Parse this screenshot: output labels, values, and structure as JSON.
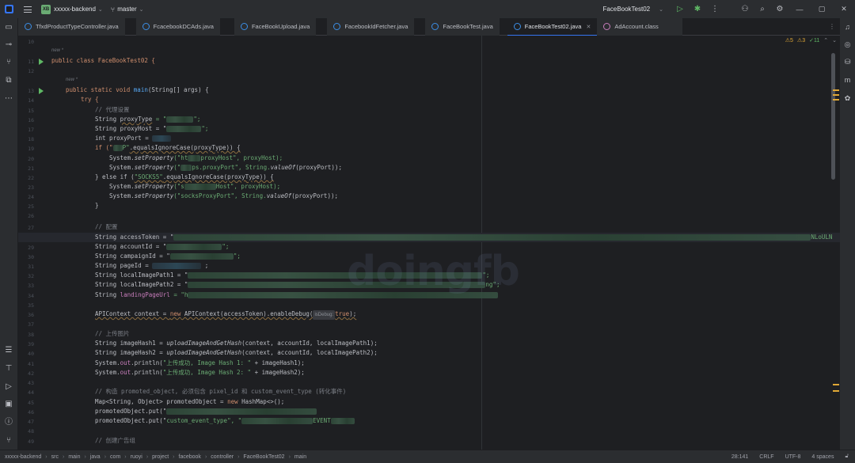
{
  "titlebar": {
    "project_badge": "XB",
    "project_name": "xxxxx-backend",
    "branch": "master",
    "run_config": "FaceBookTest02"
  },
  "tabs": [
    {
      "label": "TfxdProductTypeController.java",
      "type": "java"
    },
    {
      "label": "FcacebookDCAds.java",
      "type": "java"
    },
    {
      "label": "FaceBookUpload.java",
      "type": "java"
    },
    {
      "label": "FacebookIdFetcher.java",
      "type": "java"
    },
    {
      "label": "FaceBookTest.java",
      "type": "java"
    },
    {
      "label": "FaceBookTest02.java",
      "type": "java",
      "active": true
    },
    {
      "label": "AdAccount.class",
      "type": "class"
    }
  ],
  "inspections": {
    "warnings": "5",
    "weak_warnings": "3",
    "ok": "11"
  },
  "editor": {
    "hint_new": "new *",
    "param_hint": "isDebug:",
    "line_numbers": [
      "10",
      "11",
      "12",
      "13",
      "14",
      "15",
      "16",
      "17",
      "18",
      "19",
      "20",
      "21",
      "22",
      "23",
      "24",
      "25",
      "26",
      "27",
      "28",
      "29",
      "30",
      "31",
      "32",
      "33",
      "34",
      "35",
      "36",
      "37",
      "38",
      "39",
      "40",
      "41",
      "42",
      "43",
      "44",
      "45",
      "46",
      "47",
      "48",
      "49"
    ],
    "current_line": "28",
    "code": {
      "l11": "public class FaceBookTest02 {",
      "l13a": "public static void ",
      "l13b": "main",
      "l13c": "(String[] args) {",
      "l14": "try {",
      "l15": "// 代理设置",
      "l16a": "String ",
      "l16b": "proxyType",
      "l16c": " = \"",
      "l16d": "\";",
      "l17a": "String proxyHost = \"",
      "l17b": "\";",
      "l18": "int proxyPort = ",
      "l19a": "if (\"",
      "l19b": "P\"",
      "l19c": ".equalsIgnoreCase(proxyType)) {",
      "l20a": "System.",
      "l20b": "setProperty",
      "l20c": "(\"ht",
      "l20d": "proxyHost\", proxyHost);",
      "l21a": "System.",
      "l21b": "setProperty",
      "l21c": "(\"",
      "l21d": "ps.proxyPort\", String.",
      "l21e": "valueOf",
      "l21f": "(proxyPort));",
      "l22a": "} else if (",
      "l22b": "\"SOCKS5\"",
      "l22c": ".equalsIgnoreCase(proxyType)) {",
      "l23a": "System.",
      "l23b": "setProperty",
      "l23c": "(\"s",
      "l23d": "Host\", proxyHost);",
      "l24a": "System.",
      "l24b": "setProperty",
      "l24c": "(\"socksProxyPort\", String.",
      "l24d": "valueOf",
      "l24e": "(proxyPort));",
      "l25": "}",
      "l27": "// 配置",
      "l28a": "String accessToken = \"",
      "l28b": "NLoULN",
      "l29a": "String accountId = \"",
      "l29b": "\";",
      "l30a": "String campaignId = \"",
      "l30b": "\";",
      "l31a": "String pageId = ",
      "l31b": " ;",
      "l32a": "String localImagePath1 = \"",
      "l32b": "\";",
      "l33a": "String localImagePath2 = \"",
      "l33b": "ng\";",
      "l34a": "String ",
      "l34b": "landingPageUrl",
      "l34c": " = \"h",
      "l36a": "APIContext context = ",
      "l36b": "new",
      "l36c": " APIContext(accessToken).enableDebug(",
      "l36d": "true",
      "l36e": ");",
      "l38": "// 上传图片",
      "l39a": "String imageHash1 = ",
      "l39b": "uploadImageAndGetHash",
      "l39c": "(context, accountId, localImagePath1);",
      "l40a": "String imageHash2 = ",
      "l40b": "uploadImageAndGetHash",
      "l40c": "(context, accountId, localImagePath2);",
      "l41a": "System.",
      "l41b": "out",
      "l41c": ".println(",
      "l41d": "\"上传成功, Image Hash 1: \"",
      "l41e": " + imageHash1);",
      "l42a": "System.",
      "l42b": "out",
      "l42c": ".println(",
      "l42d": "\"上传成功, Image Hash 2: \"",
      "l42e": " + imageHash2);",
      "l44": "// 构造 promoted_object, 必须包含 pixel_id 和 custom_event_type (转化事件)",
      "l45a": "Map<String, Object> promotedObject = ",
      "l45b": "new",
      "l45c": " HashMap<>();",
      "l46a": "promotedObject.put(\"",
      "l47a": "promotedObject.put(\"",
      "l47b": "custom_event_type",
      "l47c": "\", \"",
      "l47d": "EVENT",
      "l49": "// 创建广告组"
    }
  },
  "statusbar": {
    "crumbs": [
      "xxxxx-backend",
      "src",
      "main",
      "java",
      "com",
      "ruoyi",
      "project",
      "facebook",
      "controller",
      "FaceBookTest02",
      "main"
    ],
    "position": "28:141",
    "line_sep": "CRLF",
    "encoding": "UTF-8",
    "indent": "4 spaces"
  },
  "watermark": "doingfb"
}
